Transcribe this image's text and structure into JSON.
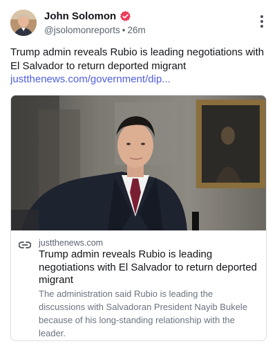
{
  "post": {
    "author_name": "John Solomon",
    "handle": "@jsolomonreports",
    "time": "26m",
    "text": "Trump admin reveals Rubio is leading negotiations with El Salvador to return deported migrant",
    "link_text": "justthenews.com/government/dip...",
    "icons": [
      "avatar-photo",
      "verified-badge-icon",
      "more-options-icon",
      "link-icon"
    ],
    "colors": {
      "link": "#4f5ee0",
      "verified": "#ee3c5a",
      "muted": "#5b6470"
    }
  },
  "card": {
    "domain": "justthenews.com",
    "title": "Trump admin reveals Rubio is leading negotiations with El Salvador to return deported migrant",
    "description": "The administration said Rubio is leading the discussions with Salvadoran President Nayib Bukele because of his long-standing relationship with the leader."
  }
}
